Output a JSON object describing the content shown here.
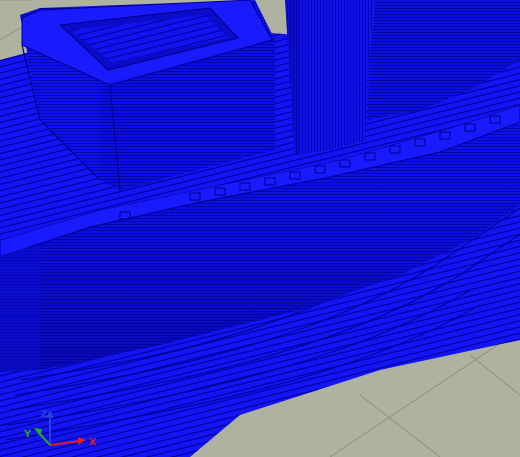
{
  "view": {
    "type": "3d-print-layer-preview",
    "subject": "boat-hull-and-cabin",
    "colors": {
      "build_plate": "#aeb29f",
      "plate_grid": "#8e927f",
      "extrusion": "#1010f0",
      "extrusion_dark": "#0a0ab8",
      "extrusion_light": "#2b2bff",
      "layer_line": "#000090"
    }
  },
  "axes": {
    "x": {
      "label": "X",
      "color": "#e02020"
    },
    "y": {
      "label": "Y",
      "color": "#20b020"
    },
    "z": {
      "label": "Z",
      "color": "#2040e0"
    }
  }
}
